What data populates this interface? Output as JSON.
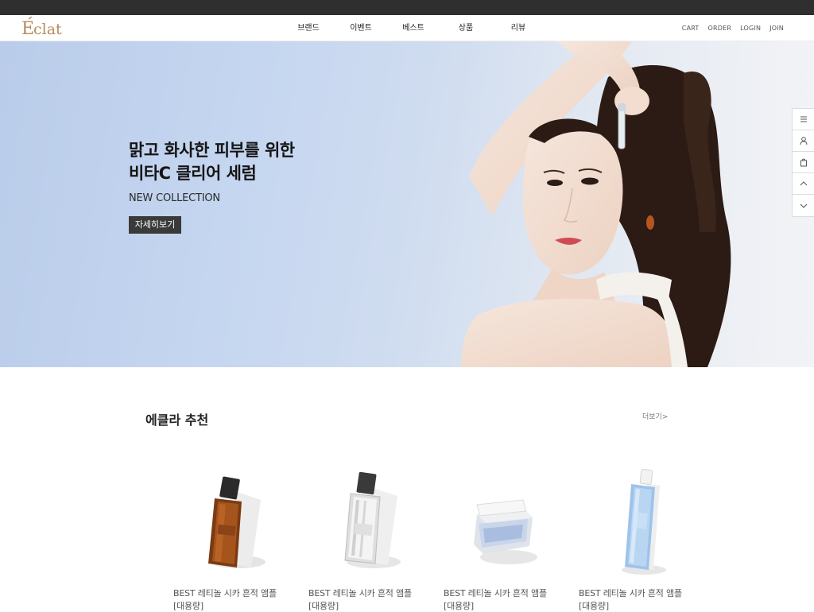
{
  "brand": {
    "logo_text": "Eclat"
  },
  "nav": {
    "items": [
      "브랜드",
      "이벤트",
      "베스트",
      "상품",
      "리뷰"
    ]
  },
  "util": {
    "items": [
      "CART",
      "ORDER",
      "LOGIN",
      "JOIN"
    ]
  },
  "hero": {
    "title_line1": "맑고 화사한 피부를 위한",
    "title_line2": "비타C 클리어 세럼",
    "subtitle": "NEW COLLECTION",
    "button_label": "자세히보기"
  },
  "quick_menu": {
    "icons": [
      "menu-icon",
      "user-icon",
      "shopping-bag-icon",
      "arrow-up-icon",
      "arrow-down-icon"
    ]
  },
  "recommend": {
    "title": "에클라 추천",
    "more_label": "더보기>",
    "products": [
      {
        "name_line1": "BEST 레티놀 시카 흔적 앰플",
        "name_line2": "[대용량]",
        "image": "amber-perfume-bottle"
      },
      {
        "name_line1": "BEST 레티놀 시카 흔적 앰플",
        "name_line2": "[대용량]",
        "image": "clear-perfume-bottle"
      },
      {
        "name_line1": "BEST 레티놀 시카 흔적 앰플",
        "name_line2": "[대용량]",
        "image": "white-cream-jar"
      },
      {
        "name_line1": "BEST 레티놀 시카 흔적 앰플",
        "name_line2": "[대용량]",
        "image": "blue-toner-bottle"
      }
    ]
  },
  "colors": {
    "top_strip": "#2f2f2f",
    "logo": "#b98a5e",
    "button": "#3a3a3a"
  }
}
